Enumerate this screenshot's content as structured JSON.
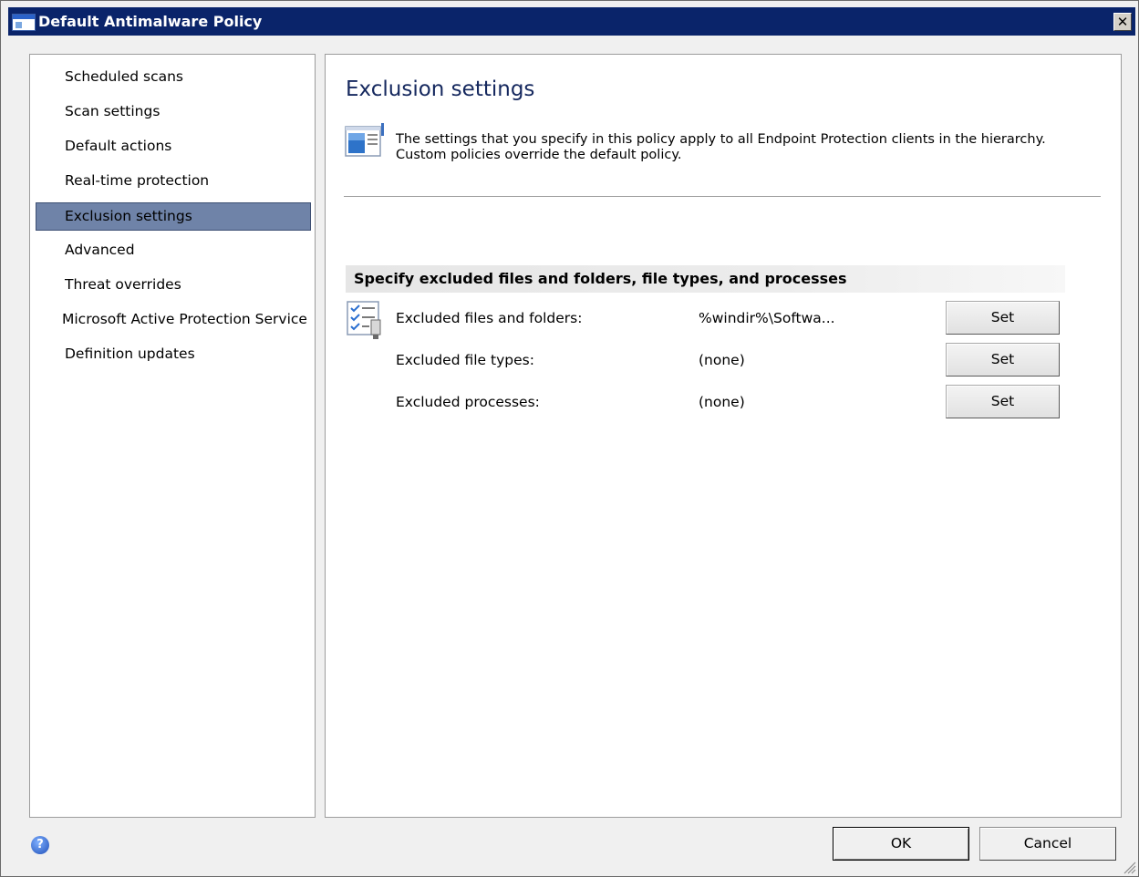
{
  "window": {
    "title": "Default Antimalware Policy",
    "close_glyph": "✕"
  },
  "nav": {
    "items": [
      {
        "label": "Scheduled scans"
      },
      {
        "label": "Scan settings"
      },
      {
        "label": "Default actions"
      },
      {
        "label": "Real-time protection"
      },
      {
        "label": "Exclusion settings",
        "selected": true
      },
      {
        "label": "Advanced"
      },
      {
        "label": "Threat overrides"
      },
      {
        "label": "Microsoft Active Protection Service"
      },
      {
        "label": "Definition updates"
      }
    ]
  },
  "main": {
    "title": "Exclusion settings",
    "info_line1": "The settings that you specify in this policy apply to all Endpoint Protection clients in the hierarchy.",
    "info_line2": "Custom policies override the default policy.",
    "section_header": "Specify excluded files and folders, file types, and processes",
    "rows": [
      {
        "label": "Excluded files and folders:",
        "value": "%windir%\\Softwa...",
        "button": "Set"
      },
      {
        "label": "Excluded file types:",
        "value": "(none)",
        "button": "Set"
      },
      {
        "label": "Excluded processes:",
        "value": "(none)",
        "button": "Set"
      }
    ]
  },
  "footer": {
    "help_glyph": "?",
    "ok_label": "OK",
    "cancel_label": "Cancel"
  },
  "colors": {
    "titlebar": "#0a246a",
    "selected_nav": "#6f83a8",
    "page_title": "#15285e"
  },
  "icons": [
    "app-window-icon",
    "close-icon",
    "policy-info-icon",
    "checklist-icon",
    "help-icon",
    "resize-grip-icon"
  ]
}
